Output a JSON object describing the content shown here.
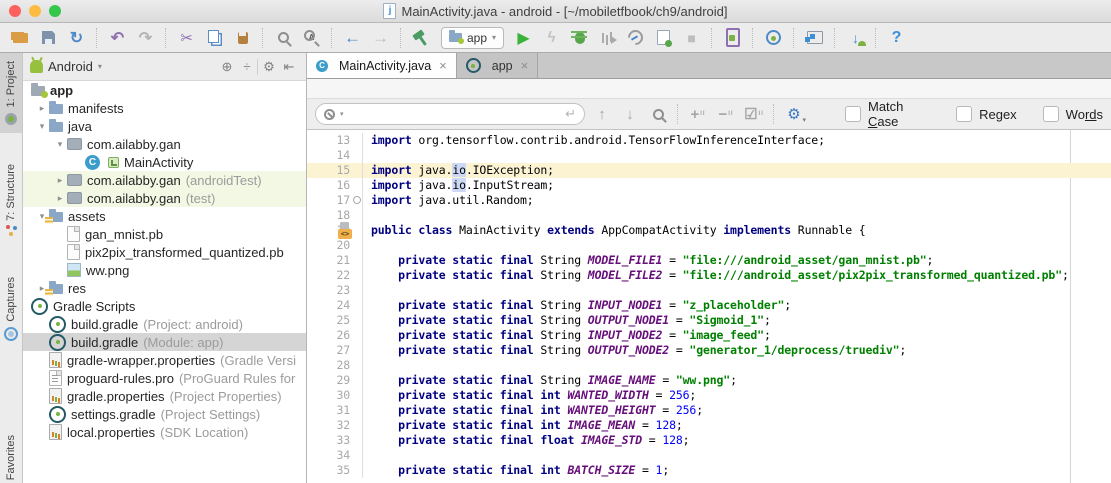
{
  "window": {
    "title": "MainActivity.java - android - [~/mobiletfbook/ch9/android]",
    "file_icon": "java-file-icon"
  },
  "colors": {
    "accent_blue": "#3E8FD6",
    "run_green": "#35B235",
    "caret_line_bg": "#FCF3D3",
    "vcs_added_row_bg": "#F2F8E3",
    "selected_row_bg": "#D5D5D5",
    "keyword": "#000080",
    "string": "#008000",
    "number": "#0000FF",
    "constant": "#660E7A"
  },
  "toolbar": {
    "items": [
      {
        "type": "icon",
        "name": "open-icon"
      },
      {
        "type": "icon",
        "name": "save-all-icon"
      },
      {
        "type": "icon",
        "name": "sync-icon",
        "glyph": "↻",
        "color": "#4E89C8"
      },
      {
        "type": "sep"
      },
      {
        "type": "icon",
        "name": "undo-icon",
        "glyph": "↶",
        "color": "#8E6FB1"
      },
      {
        "type": "icon",
        "name": "redo-icon",
        "glyph": "↷",
        "color": "#B4B4B4"
      },
      {
        "type": "sep"
      },
      {
        "type": "icon",
        "name": "cut-icon",
        "glyph": "✂",
        "color": "#8E6FB1"
      },
      {
        "type": "icon",
        "name": "copy-icon"
      },
      {
        "type": "icon",
        "name": "paste-icon"
      },
      {
        "type": "sep"
      },
      {
        "type": "icon",
        "name": "find-icon",
        "cls": "mag"
      },
      {
        "type": "icon",
        "name": "replace-icon",
        "glyph": "A"
      },
      {
        "type": "sep"
      },
      {
        "type": "icon",
        "name": "back-icon",
        "glyph": "←",
        "color": "#4E89C8"
      },
      {
        "type": "icon",
        "name": "forward-icon",
        "glyph": "→",
        "color": "#BDBDBD"
      },
      {
        "type": "sep"
      },
      {
        "type": "icon",
        "name": "build-icon"
      },
      {
        "type": "runconfig",
        "name": "run-configuration-select",
        "label": "app",
        "caret": "▾"
      },
      {
        "type": "icon",
        "name": "run-icon",
        "glyph": "▶",
        "color": "#3BB33B"
      },
      {
        "type": "icon",
        "name": "apply-changes-icon",
        "glyph": "ϟ",
        "color": "#C2C2C2"
      },
      {
        "type": "icon",
        "name": "debug-icon"
      },
      {
        "type": "icon",
        "name": "profile-icon"
      },
      {
        "type": "icon",
        "name": "profiler-icon"
      },
      {
        "type": "icon",
        "name": "attach-debugger-icon"
      },
      {
        "type": "icon",
        "name": "stop-icon",
        "glyph": "■",
        "color": "#BDBDBD"
      },
      {
        "type": "sep"
      },
      {
        "type": "icon",
        "name": "avd-manager-icon"
      },
      {
        "type": "sep"
      },
      {
        "type": "icon",
        "name": "gradle-sync-icon"
      },
      {
        "type": "sep"
      },
      {
        "type": "icon",
        "name": "sdk-manager-icon"
      },
      {
        "type": "sep"
      },
      {
        "type": "icon",
        "name": "attach-android-icon",
        "glyph": "↓",
        "color": "#3E8FD6"
      },
      {
        "type": "sep"
      },
      {
        "type": "icon",
        "name": "help-icon",
        "glyph": "?",
        "color": "#3E8FD6"
      }
    ]
  },
  "left_strip": {
    "items": [
      {
        "name": "tool-button-project",
        "label": "1: Project",
        "icon": "project-icon",
        "active": true
      },
      {
        "name": "tool-button-structure",
        "label": "7: Structure",
        "icon": "structure-icon",
        "active": false
      },
      {
        "name": "tool-button-captures",
        "label": "Captures",
        "icon": "captures-icon",
        "active": false
      },
      {
        "name": "tool-button-favorites",
        "label": "Favorites",
        "icon": null,
        "active": false
      }
    ]
  },
  "project": {
    "header": {
      "title": "Android",
      "caret": "▾",
      "icons": [
        {
          "name": "locate-file-icon",
          "glyph": "⊕"
        },
        {
          "name": "collapse-all-icon",
          "glyph": "÷"
        },
        {
          "name": "sep"
        },
        {
          "name": "settings-gear-icon",
          "glyph": "⚙"
        },
        {
          "name": "hide-panel-icon",
          "glyph": "⇤"
        }
      ]
    },
    "tree_glyphs": {
      "collapsed": "▸",
      "expanded": "▾"
    },
    "rows": [
      {
        "depth": 0,
        "icon": "app-module-icon",
        "label": "app",
        "bold": true
      },
      {
        "depth": 1,
        "chev": "r",
        "icon": "folder-icon",
        "label": "manifests"
      },
      {
        "depth": 1,
        "chev": "d",
        "icon": "folder-icon",
        "label": "java"
      },
      {
        "depth": 2,
        "chev": "d",
        "icon": "package-icon",
        "label": "com.ailabby.gan"
      },
      {
        "depth": 3,
        "icon": "class-icon",
        "icon2": "class-badge-icon",
        "label": "MainActivity"
      },
      {
        "depth": 2,
        "chev": "r",
        "icon": "package-icon",
        "label": "com.ailabby.gan",
        "suffix": "(androidTest)",
        "bg": "green"
      },
      {
        "depth": 2,
        "chev": "r",
        "icon": "package-icon",
        "label": "com.ailabby.gan",
        "suffix": "(test)",
        "bg": "green"
      },
      {
        "depth": 1,
        "chev": "d",
        "icon": "assets-folder-icon",
        "label": "assets"
      },
      {
        "depth": 2,
        "icon": "file-icon",
        "label": "gan_mnist.pb"
      },
      {
        "depth": 2,
        "icon": "file-icon",
        "label": "pix2pix_transformed_quantized.pb"
      },
      {
        "depth": 2,
        "icon": "image-file-icon",
        "label": "ww.png"
      },
      {
        "depth": 1,
        "chev": "r",
        "icon": "assets-folder-icon",
        "label": "res"
      },
      {
        "depth": 0,
        "icon": "gradle-icon",
        "label": "Gradle Scripts"
      },
      {
        "depth": 1,
        "icon": "gradle-icon",
        "label": "build.gradle",
        "suffix": "(Project: android)"
      },
      {
        "depth": 1,
        "icon": "gradle-icon",
        "label": "build.gradle",
        "suffix": "(Module: app)",
        "bg": "selected"
      },
      {
        "depth": 1,
        "icon": "properties-icon",
        "label": "gradle-wrapper.properties",
        "suffix": "(Gradle Versi"
      },
      {
        "depth": 1,
        "icon": "textfile-icon",
        "label": "proguard-rules.pro",
        "suffix": "(ProGuard Rules for"
      },
      {
        "depth": 1,
        "icon": "properties-icon",
        "label": "gradle.properties",
        "suffix": "(Project Properties)"
      },
      {
        "depth": 1,
        "icon": "gradle-icon",
        "label": "settings.gradle",
        "suffix": "(Project Settings)"
      },
      {
        "depth": 1,
        "icon": "properties-icon",
        "label": "local.properties",
        "suffix": "(SDK Location)"
      }
    ]
  },
  "tabs": [
    {
      "name": "tab-mainactivity-java",
      "label": "MainActivity.java",
      "icon": "class-icon",
      "close": "×",
      "active": true
    },
    {
      "name": "tab-app",
      "label": "app",
      "icon": "gradle-icon",
      "close": "×",
      "active": false
    }
  ],
  "search": {
    "field_value": "",
    "return_glyph": "↵",
    "icons": [
      {
        "name": "previous-occurrence-icon",
        "glyph": "↑"
      },
      {
        "name": "next-occurrence-icon",
        "glyph": "↓"
      },
      {
        "name": "find-all-icon",
        "glyph": "",
        "cls": "mag"
      },
      {
        "name": "sep"
      },
      {
        "name": "add-occurrence-icon",
        "glyph": "+",
        "cls": "occ"
      },
      {
        "name": "remove-occurrence-icon",
        "glyph": "−",
        "cls": "occ"
      },
      {
        "name": "select-all-occurrences-icon",
        "glyph": "☑",
        "cls": "occ"
      },
      {
        "name": "sep"
      },
      {
        "name": "search-settings-icon",
        "glyph": "⚙",
        "cls": "gearblue"
      }
    ],
    "checkboxes": [
      {
        "name": "match-case-checkbox",
        "parts": [
          "Match ",
          "C",
          "ase"
        ],
        "checked": false
      },
      {
        "name": "regex-checkbox",
        "parts": [
          "Re",
          "g",
          "ex"
        ],
        "checked": false
      },
      {
        "name": "words-checkbox",
        "parts": [
          "Wo",
          "rd",
          "s"
        ],
        "checked": false
      }
    ]
  },
  "editor": {
    "gutter_badge_text": "<>",
    "lines": [
      {
        "n": 13,
        "seg": [
          [
            "kw",
            "import"
          ],
          [
            "p",
            " org.tensorflow.contrib.android.TensorFlowInferenceInterface;"
          ]
        ]
      },
      {
        "n": 14,
        "seg": []
      },
      {
        "n": 15,
        "current": true,
        "seg": [
          [
            "kw",
            "import"
          ],
          [
            "p",
            " java."
          ],
          [
            "hl",
            "io"
          ],
          [
            "p",
            ".IOException;"
          ]
        ]
      },
      {
        "n": 16,
        "seg": [
          [
            "kw",
            "import"
          ],
          [
            "p",
            " java."
          ],
          [
            "hl",
            "io"
          ],
          [
            "p",
            ".InputStream;"
          ]
        ]
      },
      {
        "n": 17,
        "gutter": "fold",
        "seg": [
          [
            "kw",
            "import"
          ],
          [
            "p",
            " java.util.Random;"
          ]
        ]
      },
      {
        "n": 18,
        "seg": []
      },
      {
        "n": 19,
        "gutter": "class",
        "seg": [
          [
            "kw",
            "public class"
          ],
          [
            "p",
            " MainActivity "
          ],
          [
            "kw",
            "extends"
          ],
          [
            "p",
            " AppCompatActivity "
          ],
          [
            "kw",
            "implements"
          ],
          [
            "p",
            " Runnable {"
          ]
        ]
      },
      {
        "n": 20,
        "seg": []
      },
      {
        "n": 21,
        "seg": [
          [
            "p",
            "    "
          ],
          [
            "kw",
            "private static final"
          ],
          [
            "p",
            " String "
          ],
          [
            "cst",
            "MODEL_FILE1"
          ],
          [
            "p",
            " = "
          ],
          [
            "str",
            "\"file:///android_asset/gan_mnist.pb\""
          ],
          [
            "p",
            ";"
          ]
        ]
      },
      {
        "n": 22,
        "seg": [
          [
            "p",
            "    "
          ],
          [
            "kw",
            "private static final"
          ],
          [
            "p",
            " String "
          ],
          [
            "cst",
            "MODEL_FILE2"
          ],
          [
            "p",
            " = "
          ],
          [
            "str",
            "\"file:///android_asset/pix2pix_transformed_quantized.pb\""
          ],
          [
            "p",
            ";"
          ]
        ]
      },
      {
        "n": 23,
        "seg": []
      },
      {
        "n": 24,
        "seg": [
          [
            "p",
            "    "
          ],
          [
            "kw",
            "private static final"
          ],
          [
            "p",
            " String "
          ],
          [
            "cst",
            "INPUT_NODE1"
          ],
          [
            "p",
            " = "
          ],
          [
            "str",
            "\"z_placeholder\""
          ],
          [
            "p",
            ";"
          ]
        ]
      },
      {
        "n": 25,
        "seg": [
          [
            "p",
            "    "
          ],
          [
            "kw",
            "private static final"
          ],
          [
            "p",
            " String "
          ],
          [
            "cst",
            "OUTPUT_NODE1"
          ],
          [
            "p",
            " = "
          ],
          [
            "str",
            "\"Sigmoid_1\""
          ],
          [
            "p",
            ";"
          ]
        ]
      },
      {
        "n": 26,
        "seg": [
          [
            "p",
            "    "
          ],
          [
            "kw",
            "private static final"
          ],
          [
            "p",
            " String "
          ],
          [
            "cst",
            "INPUT_NODE2"
          ],
          [
            "p",
            " = "
          ],
          [
            "str",
            "\"image_feed\""
          ],
          [
            "p",
            ";"
          ]
        ]
      },
      {
        "n": 27,
        "seg": [
          [
            "p",
            "    "
          ],
          [
            "kw",
            "private static final"
          ],
          [
            "p",
            " String "
          ],
          [
            "cst",
            "OUTPUT_NODE2"
          ],
          [
            "p",
            " = "
          ],
          [
            "str",
            "\"generator_1/deprocess/truediv\""
          ],
          [
            "p",
            ";"
          ]
        ]
      },
      {
        "n": 28,
        "seg": []
      },
      {
        "n": 29,
        "seg": [
          [
            "p",
            "    "
          ],
          [
            "kw",
            "private static final"
          ],
          [
            "p",
            " String "
          ],
          [
            "cst",
            "IMAGE_NAME"
          ],
          [
            "p",
            " = "
          ],
          [
            "str",
            "\"ww.png\""
          ],
          [
            "p",
            ";"
          ]
        ]
      },
      {
        "n": 30,
        "seg": [
          [
            "p",
            "    "
          ],
          [
            "kw",
            "private static final int"
          ],
          [
            "p",
            " "
          ],
          [
            "cst",
            "WANTED_WIDTH"
          ],
          [
            "p",
            " = "
          ],
          [
            "num",
            "256"
          ],
          [
            "p",
            ";"
          ]
        ]
      },
      {
        "n": 31,
        "seg": [
          [
            "p",
            "    "
          ],
          [
            "kw",
            "private static final int"
          ],
          [
            "p",
            " "
          ],
          [
            "cst",
            "WANTED_HEIGHT"
          ],
          [
            "p",
            " = "
          ],
          [
            "num",
            "256"
          ],
          [
            "p",
            ";"
          ]
        ]
      },
      {
        "n": 32,
        "seg": [
          [
            "p",
            "    "
          ],
          [
            "kw",
            "private static final int"
          ],
          [
            "p",
            " "
          ],
          [
            "cst",
            "IMAGE_MEAN"
          ],
          [
            "p",
            " = "
          ],
          [
            "num",
            "128"
          ],
          [
            "p",
            ";"
          ]
        ]
      },
      {
        "n": 33,
        "seg": [
          [
            "p",
            "    "
          ],
          [
            "kw",
            "private static final float"
          ],
          [
            "p",
            " "
          ],
          [
            "cst",
            "IMAGE_STD"
          ],
          [
            "p",
            " = "
          ],
          [
            "num",
            "128"
          ],
          [
            "p",
            ";"
          ]
        ]
      },
      {
        "n": 34,
        "seg": []
      },
      {
        "n": 35,
        "seg": [
          [
            "p",
            "    "
          ],
          [
            "kw",
            "private static final int"
          ],
          [
            "p",
            " "
          ],
          [
            "cst",
            "BATCH_SIZE"
          ],
          [
            "p",
            " = "
          ],
          [
            "num",
            "1"
          ],
          [
            "p",
            ";"
          ]
        ]
      }
    ]
  }
}
